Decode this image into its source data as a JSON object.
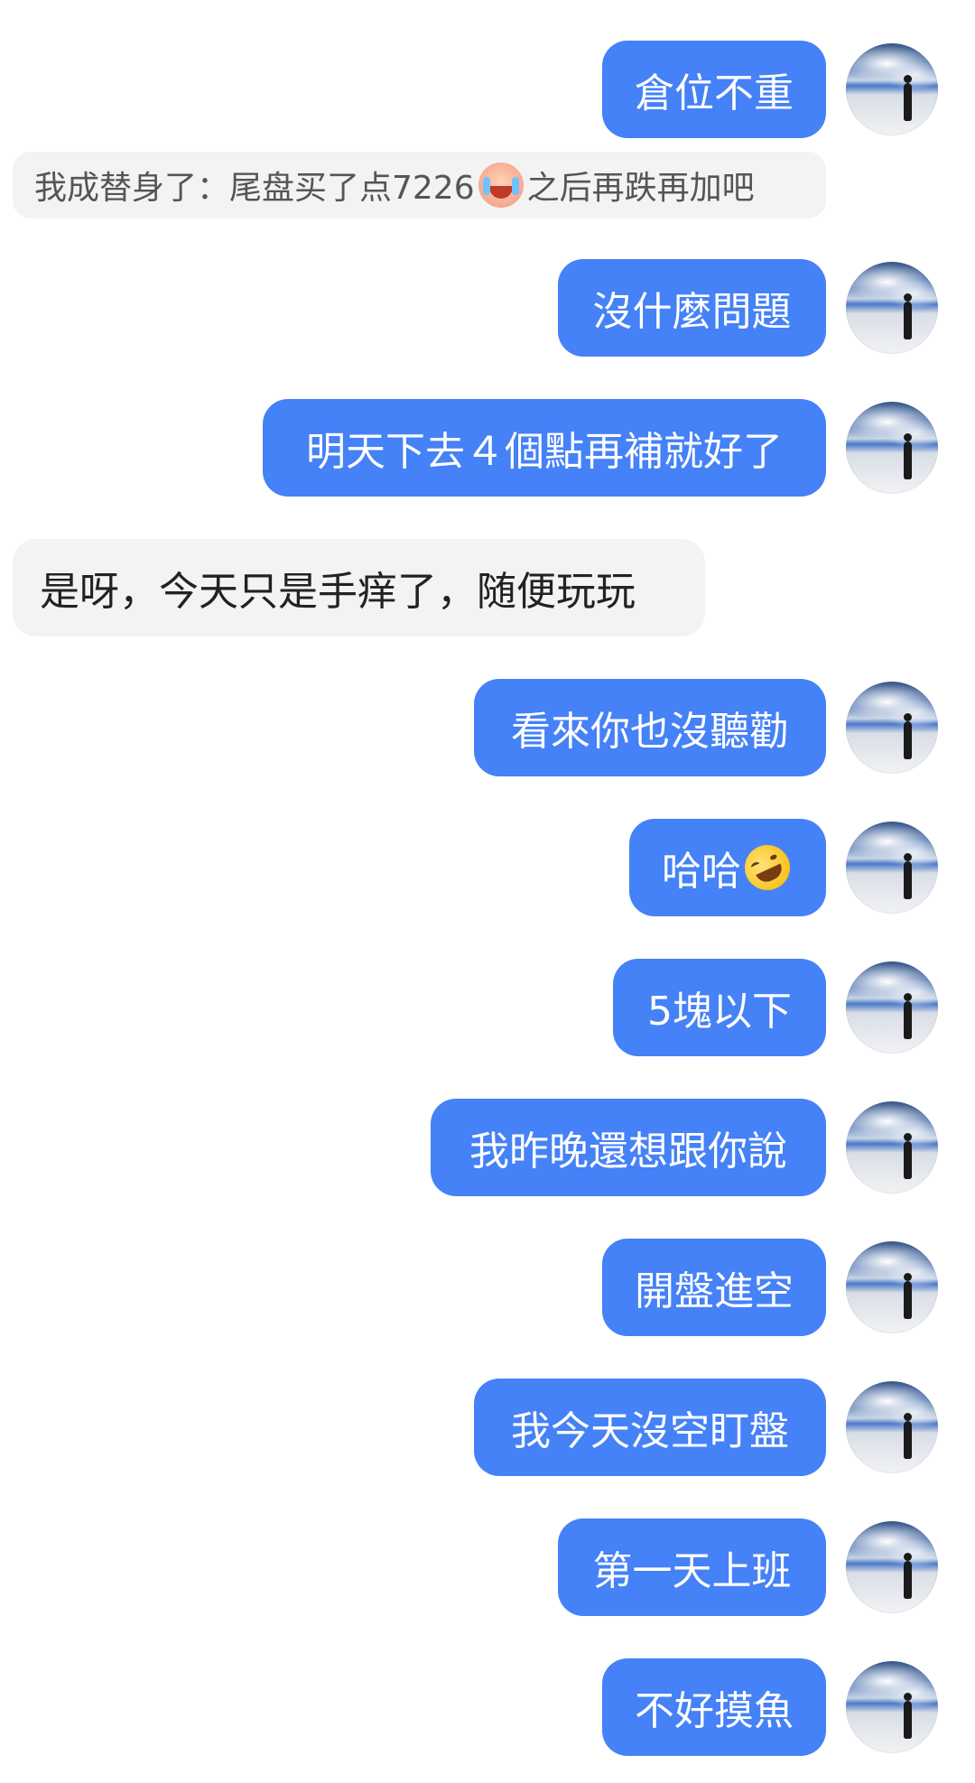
{
  "colors": {
    "outgoing_bubble": "#4581f7",
    "incoming_bubble": "#f3f3f3",
    "background": "#ffffff"
  },
  "messages": [
    {
      "direction": "outgoing",
      "text": "倉位不重"
    },
    {
      "direction": "quote",
      "text_before": "我成替身了：尾盘买了点7226",
      "emoji": "crying-face-emoji",
      "text_after": "之后再跌再加吧"
    },
    {
      "direction": "outgoing",
      "text": "沒什麼問題"
    },
    {
      "direction": "outgoing",
      "text": "明天下去４個點再補就好了"
    },
    {
      "direction": "incoming",
      "text": "是呀，今天只是手痒了，随便玩玩"
    },
    {
      "direction": "outgoing",
      "text": "看來你也沒聽勸"
    },
    {
      "direction": "outgoing",
      "text": "哈哈",
      "emoji": "rolling-laughing-emoji"
    },
    {
      "direction": "outgoing",
      "text": "5塊以下"
    },
    {
      "direction": "outgoing",
      "text": "我昨晚還想跟你說"
    },
    {
      "direction": "outgoing",
      "text": "開盤進空"
    },
    {
      "direction": "outgoing",
      "text": "我今天沒空盯盤"
    },
    {
      "direction": "outgoing",
      "text": "第一天上班"
    },
    {
      "direction": "outgoing",
      "text": "不好摸魚"
    }
  ]
}
